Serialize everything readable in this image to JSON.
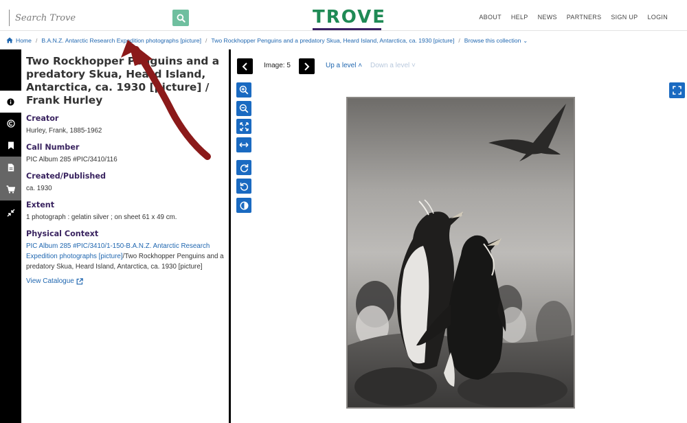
{
  "header": {
    "search_placeholder": "Search Trove",
    "logo_text": "TROVE",
    "nav": [
      "ABOUT",
      "HELP",
      "NEWS",
      "PARTNERS",
      "SIGN UP",
      "LOGIN"
    ]
  },
  "breadcrumb": {
    "home": "Home",
    "level1": "B.A.N.Z. Antarctic Research Expedition photographs [picture]",
    "level2": "Two Rockhopper Penguins and a predatory Skua, Heard Island, Antarctica, ca. 1930 [picture]",
    "browse": "Browse this collection"
  },
  "sidebar_icons": [
    "info-icon",
    "copyright-icon",
    "bookmark-icon",
    "document-icon",
    "cart-icon",
    "collapse-icon"
  ],
  "record": {
    "title": "Two Rockhopper Penguins and a predatory Skua, Heard Island, Antarctica, ca. 1930 [picture] / Frank Hurley",
    "creator_label": "Creator",
    "creator": "Hurley, Frank, 1885-1962",
    "call_number_label": "Call Number",
    "call_number": "PIC Album 285 #PIC/3410/116",
    "created_label": "Created/Published",
    "created": "ca. 1930",
    "extent_label": "Extent",
    "extent": "1 photograph : gelatin silver ; on sheet 61 x 49 cm.",
    "context_label": "Physical Context",
    "context_link": "PIC Album 285 #PIC/3410/1-150-B.A.N.Z. Antarctic Research Expedition photographs [picture]",
    "context_rest": "/Two Rockhopper Penguins and a predatory Skua, Heard Island, Antarctica, ca. 1930 [picture]",
    "view_catalogue": "View Catalogue"
  },
  "viewer": {
    "image_label": "Image: 5",
    "up_level": "Up a level",
    "down_level": "Down a level",
    "tools": [
      "zoom-in-icon",
      "zoom-out-icon",
      "fit-icon",
      "fit-width-icon",
      "rotate-right-icon",
      "rotate-left-icon",
      "contrast-icon"
    ]
  },
  "colors": {
    "brand_green": "#1f8a55",
    "brand_purple": "#3a1f63",
    "link_blue": "#2067b0",
    "tool_blue": "#1a6ac1",
    "annotation_red": "#8b1a1a"
  }
}
